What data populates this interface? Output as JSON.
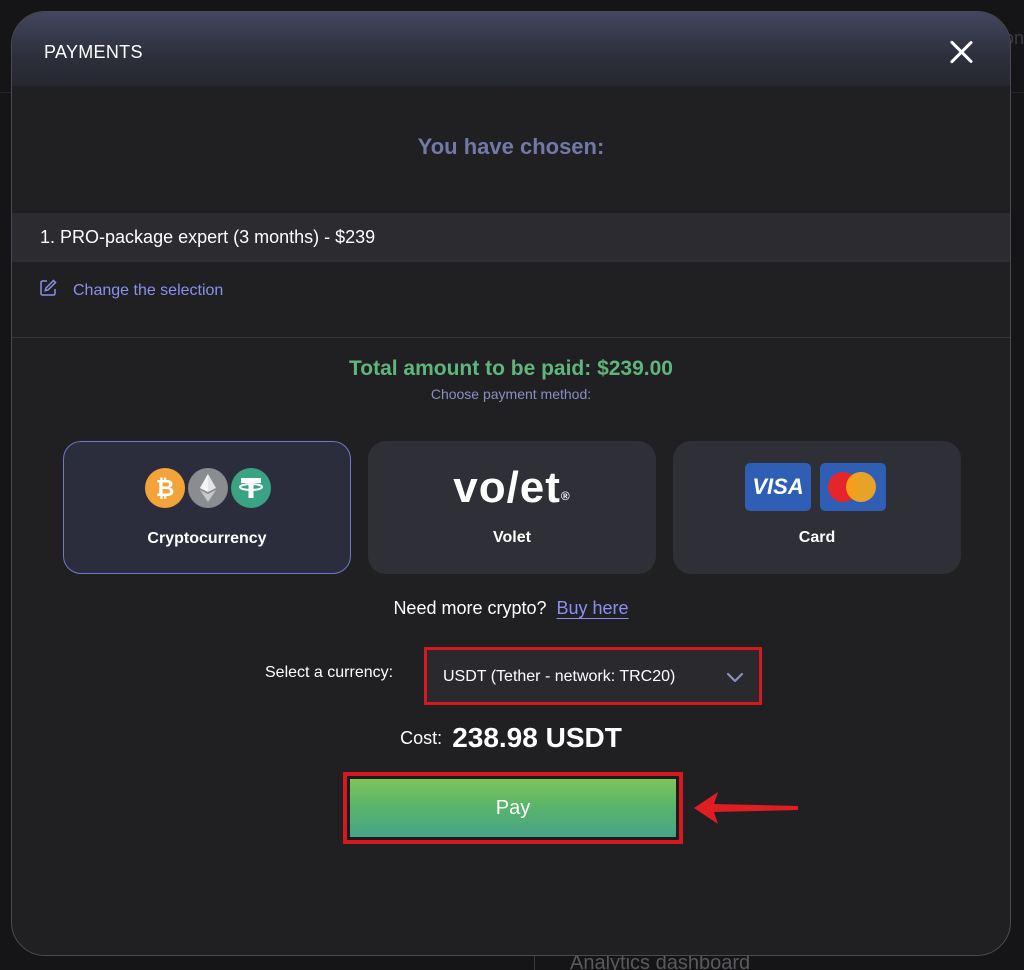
{
  "background": {
    "edge_text": "on",
    "bottom_text": "Analytics dashboard"
  },
  "modal": {
    "title": "PAYMENTS",
    "close_icon": "close-icon"
  },
  "selection": {
    "heading": "You have chosen:",
    "items": [
      {
        "number": "1.",
        "text": "PRO-package expert (3 months) - $239"
      }
    ],
    "change_label": "Change the selection",
    "change_icon": "edit-icon"
  },
  "payment": {
    "total": "Total amount to be paid: $239.00",
    "choose_method": "Choose payment method:",
    "methods": [
      {
        "label": "Cryptocurrency",
        "selected": true,
        "icons": [
          "bitcoin-icon",
          "ethereum-icon",
          "tether-icon"
        ]
      },
      {
        "label": "Volet",
        "selected": false,
        "logo_text": "vo/et"
      },
      {
        "label": "Card",
        "selected": false,
        "logo_text": "VISA",
        "icons": [
          "visa-icon",
          "mastercard-icon"
        ]
      }
    ],
    "buy_prompt": "Need more crypto?",
    "buy_link": "Buy here",
    "currency_label": "Select a currency:",
    "currency_value": "USDT (Tether - network: TRC20)",
    "cost_label": "Cost:",
    "cost_value": "238.98 USDT",
    "pay_label": "Pay"
  },
  "colors": {
    "accent": "#8b90f0",
    "total_green": "#5fb57c",
    "highlight_red": "#d8181f",
    "selected_border": "#6f78c6"
  }
}
